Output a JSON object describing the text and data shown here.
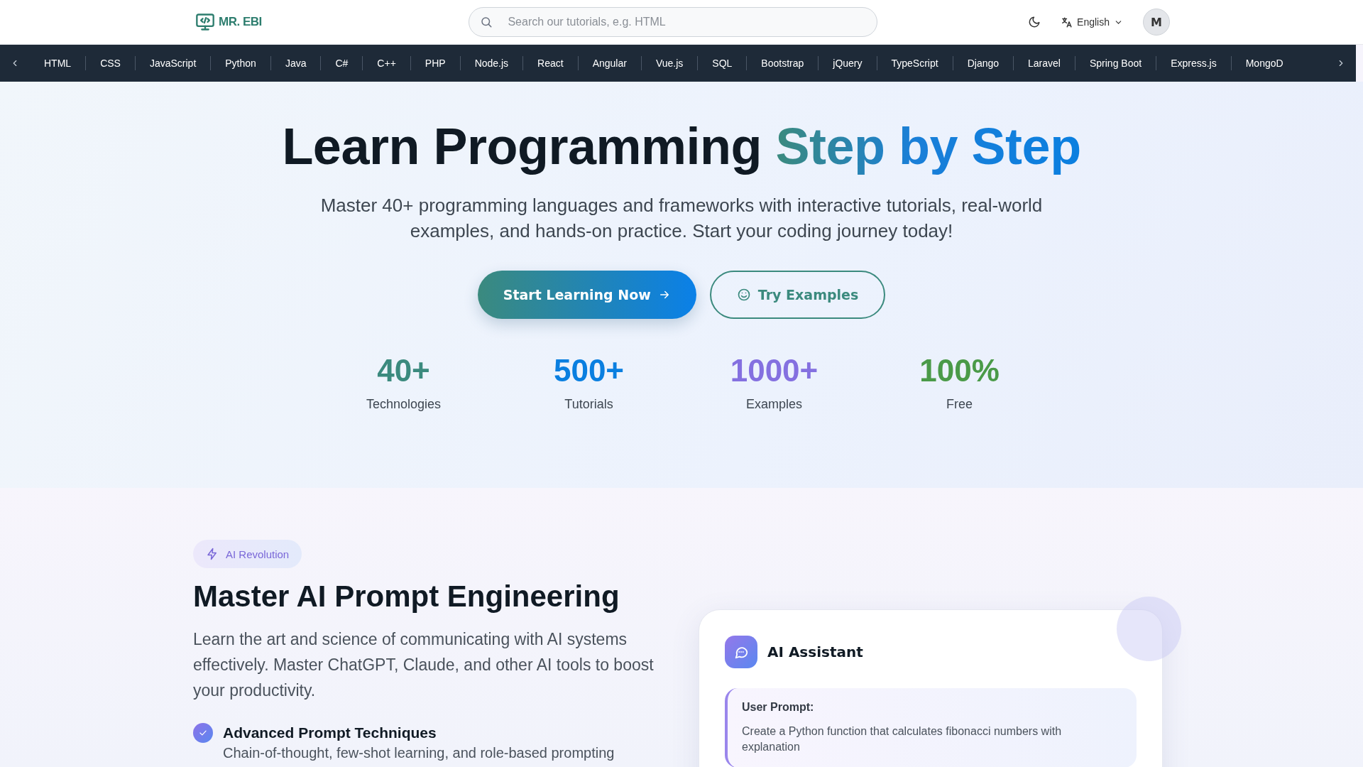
{
  "header": {
    "logo_text": "MR. EBI",
    "search": {
      "placeholder": "Search our tutorials, e.g. HTML"
    },
    "language": "English",
    "avatar": "M"
  },
  "topics": [
    "HTML",
    "CSS",
    "JavaScript",
    "Python",
    "Java",
    "C#",
    "C++",
    "PHP",
    "Node.js",
    "React",
    "Angular",
    "Vue.js",
    "SQL",
    "Bootstrap",
    "jQuery",
    "TypeScript",
    "Django",
    "Laravel",
    "Spring Boot",
    "Express.js",
    "MongoD"
  ],
  "hero": {
    "title": "Learn Programming",
    "title_highlight": "Step by Step",
    "subtitle": "Master 40+ programming languages and frameworks with interactive tutorials, real-world examples, and hands-on practice. Start your coding journey today!",
    "buttons": [
      {
        "label": "Start Learning Now",
        "kind": "primary"
      },
      {
        "label": "Try Examples",
        "kind": "outline"
      }
    ],
    "stats": [
      {
        "value": "40+",
        "label": "Technologies",
        "color": "#3b8a7e"
      },
      {
        "value": "500+",
        "label": "Tutorials",
        "color": "#0a7fe0"
      },
      {
        "value": "1000+",
        "label": "Examples",
        "color": "#8470e0"
      },
      {
        "value": "100%",
        "label": "Free",
        "color": "#4a9a48"
      }
    ]
  },
  "ai_section": {
    "badge": "AI Revolution",
    "title": "Master AI Prompt Engineering",
    "description": "Learn the art and science of communicating with AI systems effectively. Master ChatGPT, Claude, and other AI tools to boost your productivity.",
    "features": [
      {
        "title": "Advanced Prompt Techniques",
        "description": "Chain-of-thought, few-shot learning, and role-based prompting"
      }
    ],
    "card": {
      "title": "AI Assistant",
      "prompt_label": "User Prompt:",
      "prompt_text": "Create a Python function that calculates fibonacci numbers with explanation"
    }
  }
}
